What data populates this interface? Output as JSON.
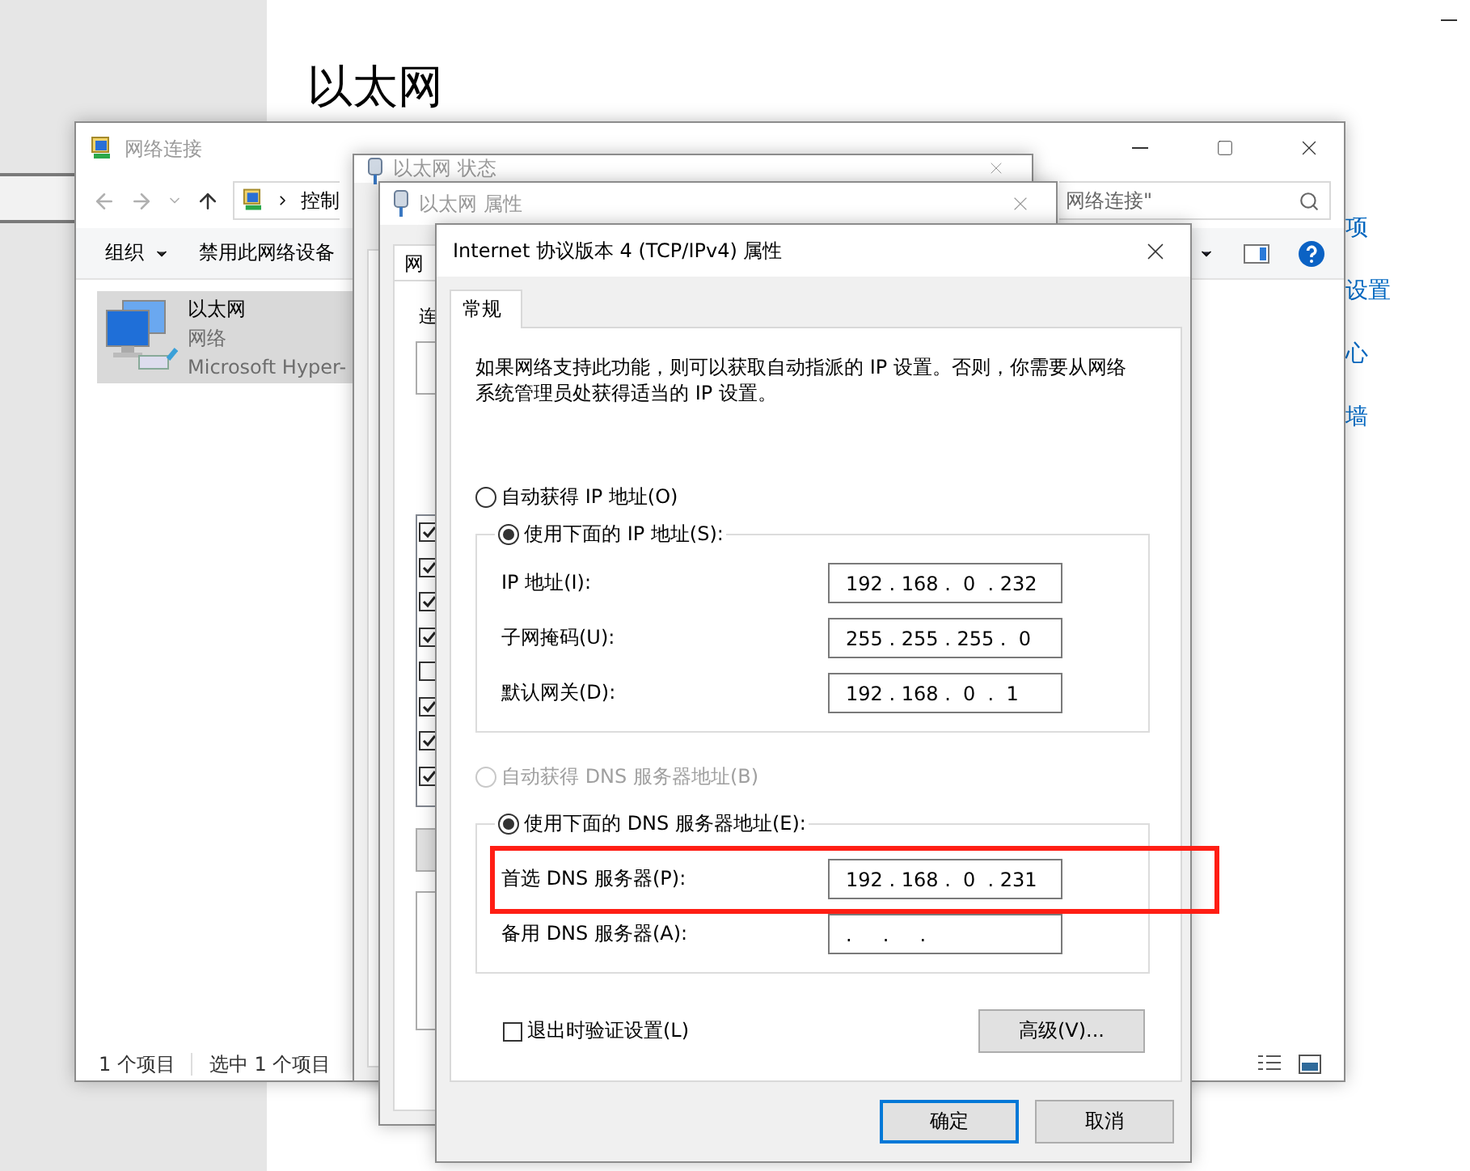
{
  "settings_page": {
    "title": "以太网",
    "links": [
      "项",
      "设置",
      "心",
      "墙"
    ]
  },
  "explorer": {
    "title": "网络连接",
    "address": "控制",
    "search": "网络连接\"",
    "toolbar": [
      "组织",
      "禁用此网络设备"
    ],
    "items": [
      {
        "name": "以太网",
        "type": "网络",
        "device": "Microsoft Hyper-",
        "selected": true
      }
    ],
    "status": [
      "1 个项目",
      "选中 1 个项目"
    ]
  },
  "status_window": {
    "title": "以太网 状态"
  },
  "properties_window": {
    "title": "以太网 属性",
    "tab": "网",
    "label": "连",
    "components": [
      {
        "checked": true
      },
      {
        "checked": true
      },
      {
        "checked": true
      },
      {
        "checked": true
      },
      {
        "checked": false
      },
      {
        "checked": true
      },
      {
        "checked": true
      },
      {
        "checked": true
      }
    ]
  },
  "dialog": {
    "title": "Internet 协议版本 4 (TCP/IPv4) 属性",
    "tabs": [
      {
        "label": "常规",
        "selected": true
      }
    ],
    "description": "如果网络支持此功能，则可以获取自动指派的 IP 设置。否则，你需要从网络系统管理员处获得适当的 IP 设置。",
    "ip_options": [
      {
        "label": "自动获得 IP 地址(O)",
        "selected": false,
        "disabled": false
      },
      {
        "label": "使用下面的 IP 地址(S):",
        "selected": true,
        "disabled": false
      }
    ],
    "ip_fields": [
      {
        "label": "IP 地址(I):",
        "value": "192 . 168 .  0  . 232"
      },
      {
        "label": "子网掩码(U):",
        "value": "255 . 255 . 255 .  0"
      },
      {
        "label": "默认网关(D):",
        "value": "192 . 168 .  0  .  1"
      }
    ],
    "dns_options": [
      {
        "label": "自动获得 DNS 服务器地址(B)",
        "selected": false,
        "disabled": true
      },
      {
        "label": "使用下面的 DNS 服务器地址(E):",
        "selected": true,
        "disabled": false
      }
    ],
    "dns_fields": [
      {
        "label": "首选 DNS 服务器(P):",
        "value": "192 . 168 .  0  . 231",
        "highlighted": true
      },
      {
        "label": "备用 DNS 服务器(A):",
        "value": ".     .     .",
        "highlighted": false
      }
    ],
    "validate": {
      "label": "退出时验证设置(L)",
      "checked": false
    },
    "advanced_button": "高级(V)...",
    "buttons": [
      {
        "label": "确定",
        "default": true
      },
      {
        "label": "取消",
        "default": false
      }
    ]
  }
}
